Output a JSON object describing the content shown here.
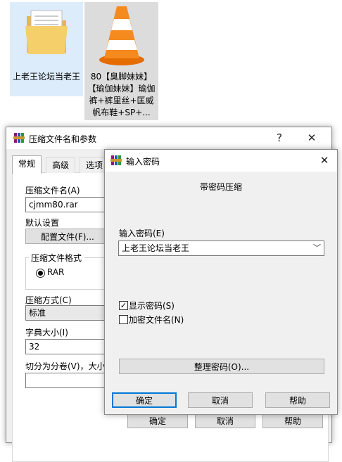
{
  "desktop": {
    "icons": [
      {
        "label": "上老王论坛当老王"
      },
      {
        "label": "80【臭脚妹妹】【瑜伽妹妹】瑜伽裤+裤里丝+匡威帆布鞋+SP+..."
      }
    ]
  },
  "archive_dialog": {
    "title": "压缩文件名和参数",
    "help_button": "?",
    "close_button": "✕",
    "tabs": [
      "常规",
      "高级",
      "选项"
    ],
    "archive_name_label": "压缩文件名(A)",
    "archive_name_value": "cjmm80.rar",
    "default_settings_label": "默认设置",
    "profiles_button": "配置文件(F)...",
    "format_group_label": "压缩文件格式",
    "format_rar": "RAR",
    "method_label": "压缩方式(C)",
    "method_value": "标准",
    "dict_label": "字典大小(I)",
    "dict_value": "32",
    "split_label": "切分为分卷(V)，大小",
    "ok_button": "确定",
    "cancel_button": "取消",
    "help_bottom_button": "帮助"
  },
  "password_dialog": {
    "title": "输入密码",
    "close_button": "✕",
    "header": "带密码压缩",
    "enter_password_label": "输入密码(E)",
    "password_value": "上老王论坛当老王",
    "show_password_label": "显示密码(S)",
    "show_password_checked": true,
    "encrypt_names_label": "加密文件名(N)",
    "encrypt_names_checked": false,
    "organize_button": "整理密码(O)...",
    "ok_button": "确定",
    "cancel_button": "取消",
    "help_button": "帮助"
  }
}
